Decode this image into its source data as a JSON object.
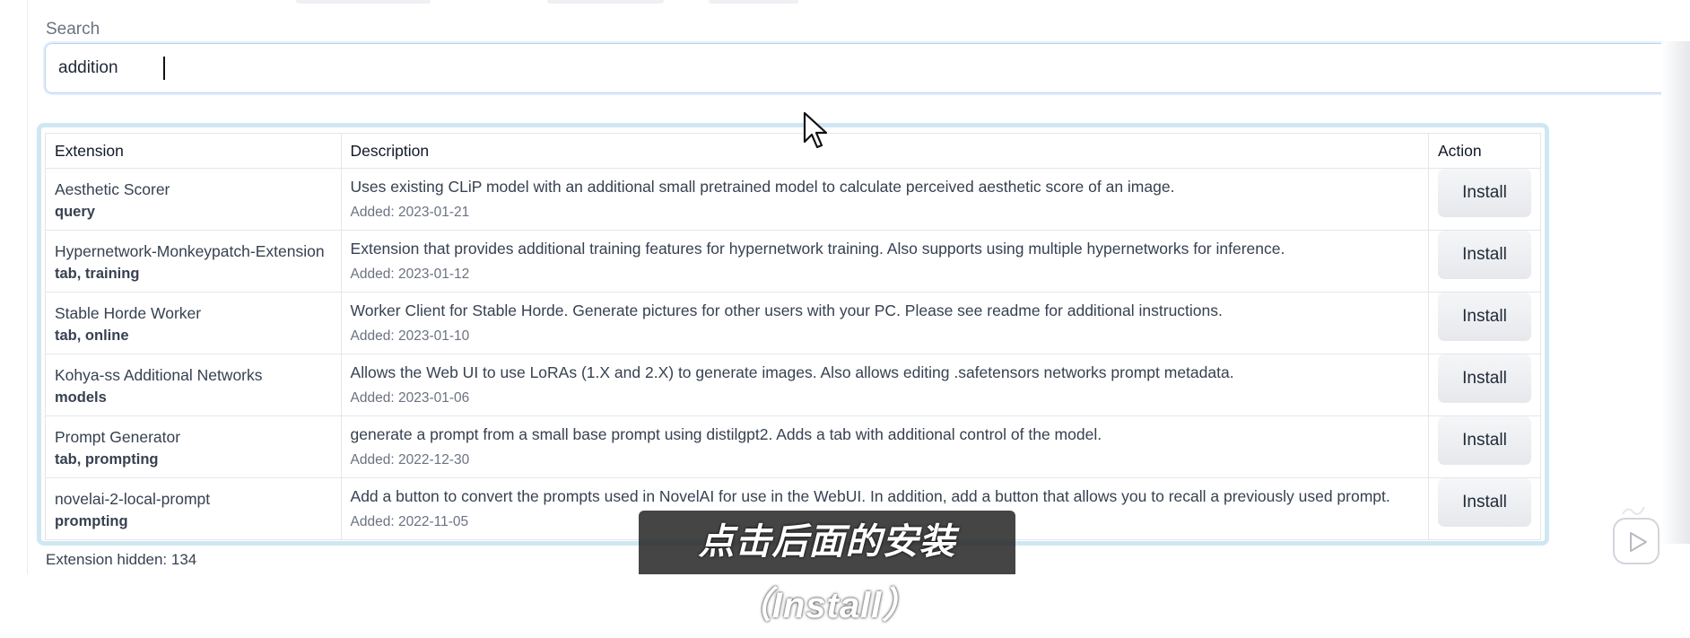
{
  "search": {
    "label": "Search",
    "value": "addition"
  },
  "table": {
    "headers": {
      "extension": "Extension",
      "description": "Description",
      "action": "Action"
    },
    "rows": [
      {
        "name": "Aesthetic Scorer",
        "tags": "query",
        "description": "Uses existing CLiP model with an additional small pretrained model to calculate perceived aesthetic score of an image.",
        "added": "Added: 2023-01-21",
        "action": "Install"
      },
      {
        "name": "Hypernetwork-Monkeypatch-Extension",
        "tags": "tab, training",
        "description": "Extension that provides additional training features for hypernetwork training. Also supports using multiple hypernetworks for inference.",
        "added": "Added: 2023-01-12",
        "action": "Install"
      },
      {
        "name": "Stable Horde Worker",
        "tags": "tab, online",
        "description": "Worker Client for Stable Horde. Generate pictures for other users with your PC. Please see readme for additional instructions.",
        "added": "Added: 2023-01-10",
        "action": "Install"
      },
      {
        "name": "Kohya-ss Additional Networks",
        "tags": "models",
        "description": "Allows the Web UI to use LoRAs (1.X and 2.X) to generate images. Also allows editing .safetensors networks prompt metadata.",
        "added": "Added: 2023-01-06",
        "action": "Install"
      },
      {
        "name": "Prompt Generator",
        "tags": "tab, prompting",
        "description": "generate a prompt from a small base prompt using distilgpt2. Adds a tab with additional control of the model.",
        "added": "Added: 2022-12-30",
        "action": "Install"
      },
      {
        "name": "novelai-2-local-prompt",
        "tags": "prompting",
        "description": "Add a button to convert the prompts used in NovelAI for use in the WebUI. In addition, add a button that allows you to recall a previously used prompt.",
        "added": "Added: 2022-11-05",
        "action": "Install"
      }
    ]
  },
  "footer": {
    "hidden_text": "Extension hidden: 134"
  },
  "subtitle": "点击后面的安装（Install）",
  "icons": {
    "cursor": "mouse-pointer-icon",
    "play": "play-icon"
  },
  "colors": {
    "frame": "#cfe7f3",
    "search_border": "#bcd3f5",
    "button_bg": "#eceef1"
  }
}
